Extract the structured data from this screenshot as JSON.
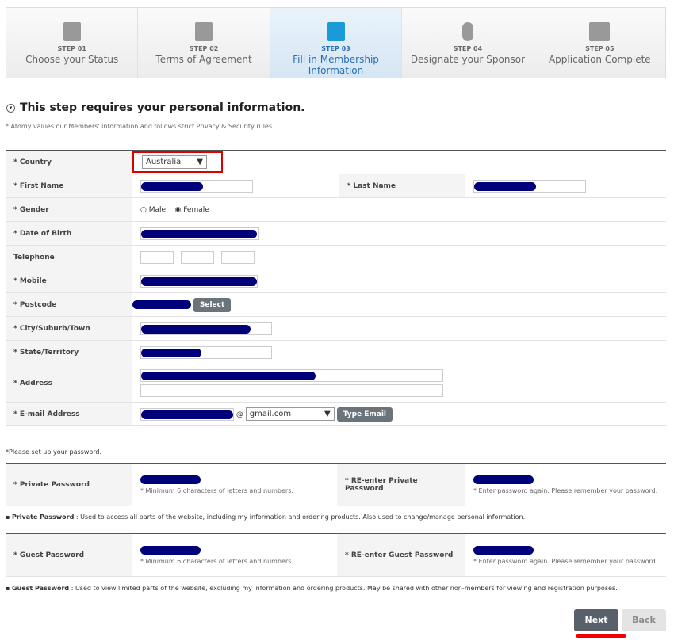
{
  "steps": [
    {
      "num": "STEP 01",
      "name": "Choose your Status",
      "icon": "id-card-icon"
    },
    {
      "num": "STEP 02",
      "name": "Terms of Agreement",
      "icon": "document-check-icon"
    },
    {
      "num": "STEP 03",
      "name": "Fill in Membership Information",
      "icon": "edit-document-icon",
      "active": true
    },
    {
      "num": "STEP 04",
      "name": "Designate your Sponsor",
      "icon": "hand-pointer-icon"
    },
    {
      "num": "STEP 05",
      "name": "Application Complete",
      "icon": "monitor-icon"
    }
  ],
  "heading": "This step requires your personal information.",
  "subtext": "* Atomy values our Members' information and follows strict Privacy & Security rules.",
  "form": {
    "country": "* Country",
    "country_value": "Australia",
    "first_name": "* First Name",
    "last_name": "* Last Name",
    "gender": "* Gender",
    "male": "Male",
    "female": "Female",
    "dob": "* Date of Birth",
    "telephone": "Telephone",
    "tel_sep": "-",
    "mobile": "* Mobile",
    "postcode": "* Postcode",
    "select": "Select",
    "city": "* City/Suburb/Town",
    "state": "* State/Territory",
    "address": "* Address",
    "email": "* E-mail Address",
    "at": "@",
    "email_domain": "gmail.com",
    "type_email": "Type Email"
  },
  "password": {
    "intro": "*Please set up your password.",
    "private": "* Private Password",
    "re_private": "* RE-enter Private Password",
    "guest": "* Guest Password",
    "re_guest": "* RE-enter Guest Password",
    "min_hint": "* Minimum 6 characters of letters and numbers.",
    "re_hint": "* Enter password again. Please remember your password.",
    "private_note_label": "Private Password",
    "private_note": " : Used to access all parts of the website, including my information and ordering products. Also used to change/manage personal information.",
    "guest_note_label": "Guest Password",
    "guest_note": " : Used to view limited parts of the website, excluding my information and ordering products. May be shared with other non-members for viewing and registration purposes."
  },
  "buttons": {
    "next": "Next",
    "back": "Back"
  }
}
